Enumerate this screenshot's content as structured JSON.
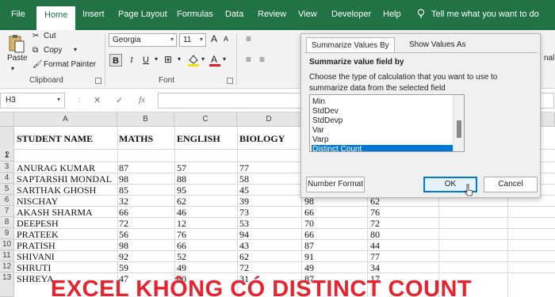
{
  "menu": {
    "tabs": [
      "File",
      "Home",
      "Insert",
      "Page Layout",
      "Formulas",
      "Data",
      "Review",
      "View",
      "Developer",
      "Help"
    ],
    "active": "Home",
    "tell_me": "Tell me what you want to do"
  },
  "ribbon": {
    "clipboard": {
      "paste": "Paste",
      "cut": "Cut",
      "copy": "Copy",
      "format_painter": "Format Painter",
      "label": "Clipboard"
    },
    "font": {
      "family": "Georgia",
      "size": "11",
      "bold": "B",
      "italic": "I",
      "underline": "U",
      "label": "Font",
      "grow": "A",
      "shrink": "A"
    },
    "right_text": "nal"
  },
  "formula_bar": {
    "name_box": "H3",
    "cancel": "✕",
    "enter": "✓",
    "fx": "fx"
  },
  "columns": [
    "A",
    "B",
    "C",
    "D"
  ],
  "rows": [
    "1",
    "2",
    "3",
    "4",
    "5",
    "6",
    "7",
    "8",
    "9",
    "10",
    "11",
    "12",
    "13"
  ],
  "table": {
    "headers": [
      "STUDENT NAME",
      "MATHS",
      "ENGLISH",
      "BIOLOGY"
    ],
    "rows": [
      [
        "ANURAG KUMAR",
        "87",
        "57",
        "77",
        "",
        ""
      ],
      [
        "SAPTARSHI MONDAL",
        "98",
        "88",
        "58",
        "",
        ""
      ],
      [
        "SARTHAK GHOSH",
        "85",
        "95",
        "45",
        "",
        ""
      ],
      [
        "NISCHAY",
        "32",
        "62",
        "39",
        "98",
        "62"
      ],
      [
        "AKASH SHARMA",
        "66",
        "46",
        "73",
        "66",
        "76"
      ],
      [
        "DEEPESH",
        "72",
        "12",
        "53",
        "70",
        "72"
      ],
      [
        "PRATEEK",
        "56",
        "76",
        "94",
        "66",
        "80"
      ],
      [
        "PRATISH",
        "98",
        "66",
        "43",
        "87",
        "44"
      ],
      [
        "SHIVANI",
        "92",
        "52",
        "62",
        "91",
        "77"
      ],
      [
        "SHRUTI",
        "59",
        "49",
        "72",
        "49",
        "34"
      ],
      [
        "SHREYA",
        "47",
        "60",
        "31",
        "87",
        "17"
      ]
    ]
  },
  "dialog": {
    "tabs": [
      "Summarize Values By",
      "Show Values As"
    ],
    "title": "Summarize value field by",
    "description": "Choose the type of calculation that you want to use to summarize data from the selected field",
    "list": [
      "Min",
      "StdDev",
      "StdDevp",
      "Var",
      "Varp",
      "Distinct Count"
    ],
    "selected": "Distinct Count",
    "number_format": "Number Format",
    "ok": "OK",
    "cancel": "Cancel"
  },
  "banner": "EXCEL KHÔNG CÓ DISTINCT COUNT",
  "colors": {
    "excel_green": "#217346",
    "selection_blue": "#0078d7",
    "banner_red": "#e8232f"
  }
}
